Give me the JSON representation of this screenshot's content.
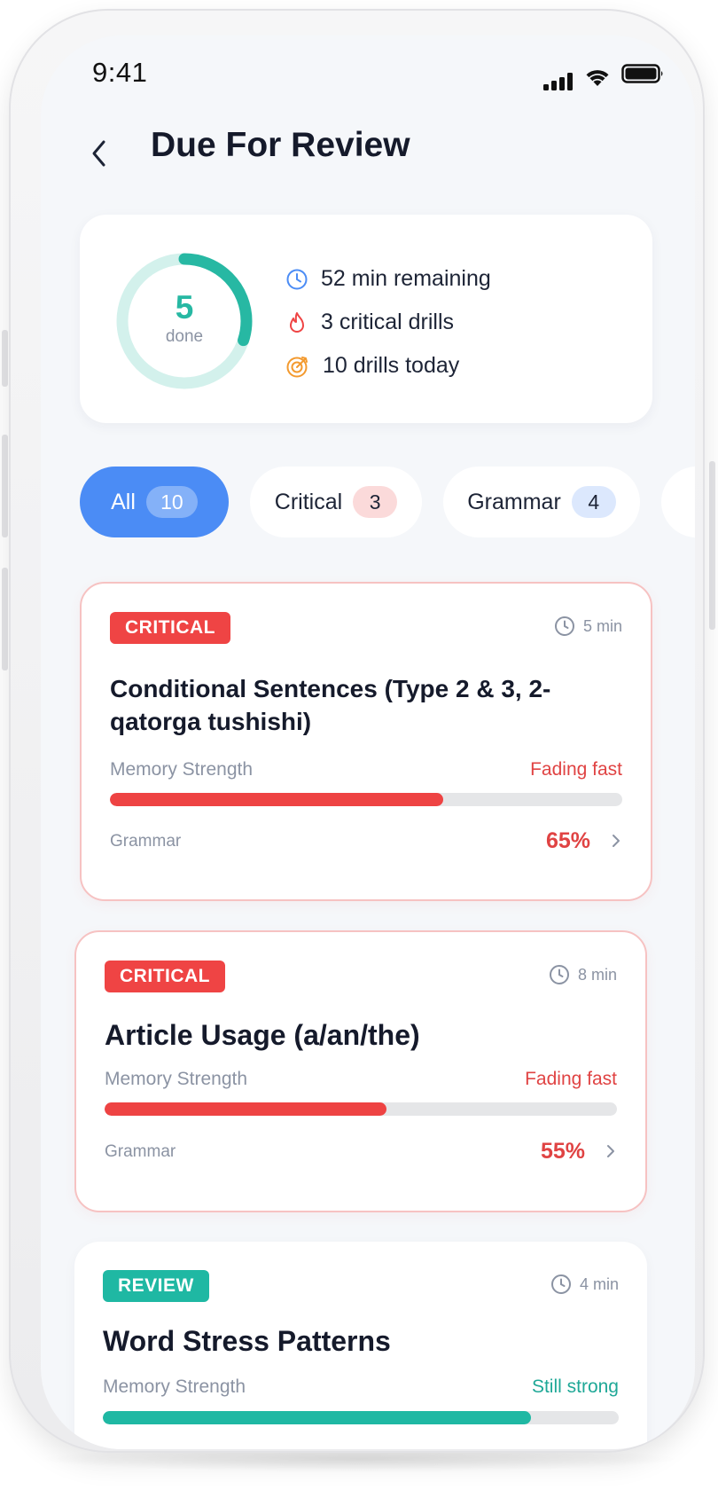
{
  "status_bar": {
    "time": "9:41"
  },
  "header": {
    "title": "Due For Review"
  },
  "summary": {
    "done_count": "5",
    "done_label": "done",
    "progress_fraction": 0.3,
    "stats": [
      {
        "icon": "clock-icon",
        "text": "52 min remaining"
      },
      {
        "icon": "flame-icon",
        "text": "3 critical drills"
      },
      {
        "icon": "target-icon",
        "text": "10 drills today"
      }
    ]
  },
  "filters": [
    {
      "label": "All",
      "count": "10",
      "selected": true
    },
    {
      "label": "Critical",
      "count": "3"
    },
    {
      "label": "Grammar",
      "count": "4"
    }
  ],
  "drills": [
    {
      "tag": "CRITICAL",
      "duration": "5 min",
      "title": "Conditional Sentences (Type 2 & 3, 2-qatorga tushishi)",
      "strength_label": "Memory Strength",
      "strength_status": "Fading fast",
      "strength": 0.65,
      "category": "Grammar",
      "percent": "65%"
    },
    {
      "tag": "CRITICAL",
      "duration": "8 min",
      "title": "Article Usage (a/an/the)",
      "strength_label": "Memory Strength",
      "strength_status": "Fading fast",
      "strength": 0.55,
      "category": "Grammar",
      "percent": "55%"
    },
    {
      "tag": "REVIEW",
      "duration": "4 min",
      "title": "Word Stress Patterns",
      "strength_label": "Memory Strength",
      "strength_status": "Still strong",
      "strength": 0.83
    }
  ],
  "colors": {
    "accent_blue": "#4b8cf5",
    "critical_red": "#ef4444",
    "review_teal": "#1fb8a3",
    "background": "#f5f7fa"
  }
}
